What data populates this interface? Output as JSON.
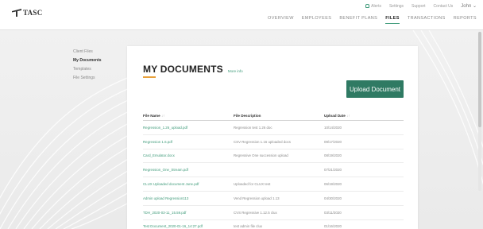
{
  "header": {
    "logo_text": "TASC",
    "utility": {
      "alerts": "Alerts",
      "settings": "Settings",
      "support": "Support",
      "contact": "Contact Us",
      "user": "John"
    },
    "nav": [
      "OVERVIEW",
      "EMPLOYEES",
      "BENEFIT PLANS",
      "FILES",
      "TRANSACTIONS",
      "REPORTS"
    ],
    "active_nav": "FILES"
  },
  "sidebar": {
    "items": [
      {
        "label": "Client Files"
      },
      {
        "label": "My Documents"
      },
      {
        "label": "Templates"
      },
      {
        "label": "File Settings"
      }
    ],
    "current": "My Documents"
  },
  "main": {
    "title": "MY DOCUMENTS",
    "more_info": "More info",
    "upload_button": "Upload Document",
    "columns": {
      "name": "File Name",
      "description": "File Description",
      "date": "Upload Date"
    },
    "rows": [
      {
        "name": "Regression_1.26_upload.pdf",
        "description": "Regression test 1.26 doc",
        "date": "10/14/2020"
      },
      {
        "name": "Regression 1.6.pdf",
        "description": "CSV Regression 1.16 uploaded docs",
        "date": "09/17/2020"
      },
      {
        "name": "Card_Emulator.docx",
        "description": "Regressive One succession upload",
        "date": "08/19/2020"
      },
      {
        "name": "Regression_One_Stream.pdf",
        "description": "",
        "date": "07/21/2020"
      },
      {
        "name": "CLUX Uploaded document June.pdf",
        "description": "Uploaded for CLUX test",
        "date": "06/19/2020"
      },
      {
        "name": "Admin upload Regression113",
        "description": "Vend Regression upload 1.13",
        "date": "04/30/2020"
      },
      {
        "name": "TDH_2020-03-11_15.59.pdf",
        "description": "CVS Regressive 1.12.5 clux",
        "date": "03/11/2020"
      },
      {
        "name": "Test Document_2020-01-16_14:27.pdf",
        "description": "test admin file clux",
        "date": "01/16/2020"
      }
    ]
  }
}
